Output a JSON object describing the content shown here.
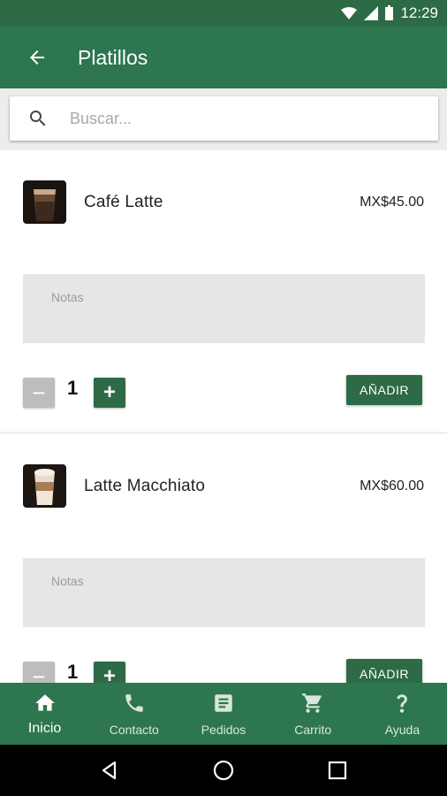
{
  "status_bar": {
    "time": "12:29"
  },
  "app_bar": {
    "title": "Platillos"
  },
  "search": {
    "placeholder": "Buscar..."
  },
  "products": [
    {
      "name": "Café Latte",
      "price": "MX$45.00",
      "notes_placeholder": "Notas",
      "quantity": "1",
      "add_label": "AÑADIR"
    },
    {
      "name": "Latte Macchiato",
      "price": "MX$60.00",
      "notes_placeholder": "Notas",
      "quantity": "1",
      "add_label": "AÑADIR"
    }
  ],
  "bottom_nav": {
    "items": [
      {
        "label": "Inicio",
        "icon": "home-icon",
        "active": true
      },
      {
        "label": "Contacto",
        "icon": "phone-icon",
        "active": false
      },
      {
        "label": "Pedidos",
        "icon": "receipt-icon",
        "active": false
      },
      {
        "label": "Carrito",
        "icon": "cart-icon",
        "active": false
      },
      {
        "label": "Ayuda",
        "icon": "help-icon",
        "active": false
      }
    ]
  },
  "colors": {
    "primary": "#2d7650",
    "primary_dark": "#2d6a46",
    "minus_button": "#bdbdbd",
    "notes_bg": "#e6e6e6"
  }
}
